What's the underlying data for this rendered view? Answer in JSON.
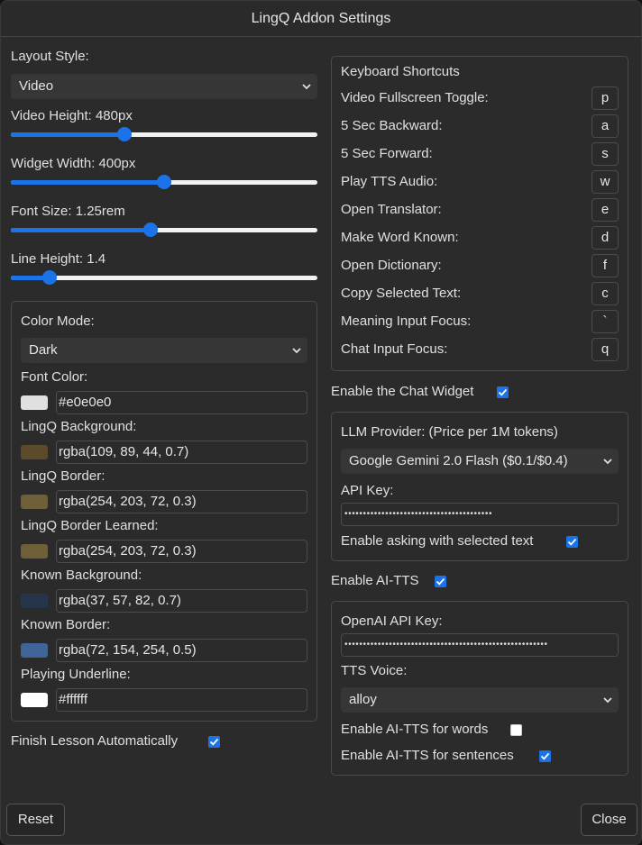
{
  "window": {
    "title": "LingQ Addon Settings"
  },
  "layout": {
    "label": "Layout Style:",
    "value": "Video",
    "video_height_label": "Video Height: 480px",
    "video_height_level": 0.37,
    "widget_width_label": "Widget Width: 400px",
    "widget_width_level": 0.5,
    "font_size_label": "Font Size: 1.25rem",
    "font_size_level": 0.455,
    "line_height_label": "Line Height: 1.4",
    "line_height_level": 0.125
  },
  "colors": {
    "mode_label": "Color Mode:",
    "mode_value": "Dark",
    "fields": [
      {
        "label": "Font Color:",
        "value": "#e0e0e0",
        "swatch": "#e0e0e0"
      },
      {
        "label": "LingQ Background:",
        "value": "rgba(109, 89, 44, 0.7)",
        "swatch": "#5b4b2a"
      },
      {
        "label": "LingQ Border:",
        "value": "rgba(254, 203, 72, 0.3)",
        "swatch": "#6f5f38"
      },
      {
        "label": "LingQ Border Learned:",
        "value": "rgba(254, 203, 72, 0.3)",
        "swatch": "#6f5f38"
      },
      {
        "label": "Known Background:",
        "value": "rgba(37, 57, 82, 0.7)",
        "swatch": "#26364a"
      },
      {
        "label": "Known Border:",
        "value": "rgba(72, 154, 254, 0.5)",
        "swatch": "#3e6498"
      },
      {
        "label": "Playing Underline:",
        "value": "#ffffff",
        "swatch": "#ffffff"
      }
    ]
  },
  "finish_lesson": {
    "label": "Finish Lesson Automatically",
    "checked": true
  },
  "shortcuts": {
    "title": "Keyboard Shortcuts",
    "items": [
      {
        "label": "Video Fullscreen Toggle:",
        "key": "p"
      },
      {
        "label": "5 Sec Backward:",
        "key": "a"
      },
      {
        "label": "5 Sec Forward:",
        "key": "s"
      },
      {
        "label": "Play TTS Audio:",
        "key": "w"
      },
      {
        "label": "Open Translator:",
        "key": "e"
      },
      {
        "label": "Make Word Known:",
        "key": "d"
      },
      {
        "label": "Open Dictionary:",
        "key": "f"
      },
      {
        "label": "Copy Selected Text:",
        "key": "c"
      },
      {
        "label": "Meaning Input Focus:",
        "key": "`"
      },
      {
        "label": "Chat Input Focus:",
        "key": "q"
      }
    ]
  },
  "chat": {
    "enable_label": "Enable the Chat Widget",
    "enabled": true,
    "provider_label": "LLM Provider: (Price per 1M tokens)",
    "provider_value": "Google Gemini 2.0 Flash ($0.1/$0.4)",
    "api_key_label": "API Key:",
    "api_key_mask": "••••••••••••••••••••••••••••••••••••••••",
    "selected_text_label": "Enable asking with selected text",
    "selected_text_enabled": true
  },
  "tts": {
    "enable_label": "Enable AI-TTS",
    "enabled": true,
    "openai_key_label": "OpenAI API Key:",
    "openai_key_mask": "•••••••••••••••••••••••••••••••••••••••••••••••••••••••",
    "voice_label": "TTS Voice:",
    "voice_value": "alloy",
    "words_label": "Enable AI-TTS for words",
    "words_enabled": false,
    "sentences_label": "Enable AI-TTS for sentences",
    "sentences_enabled": true
  },
  "footer": {
    "reset_label": "Reset",
    "close_label": "Close"
  },
  "theme": {
    "accent": "#1a73e8",
    "background": "#2b2b2b"
  }
}
